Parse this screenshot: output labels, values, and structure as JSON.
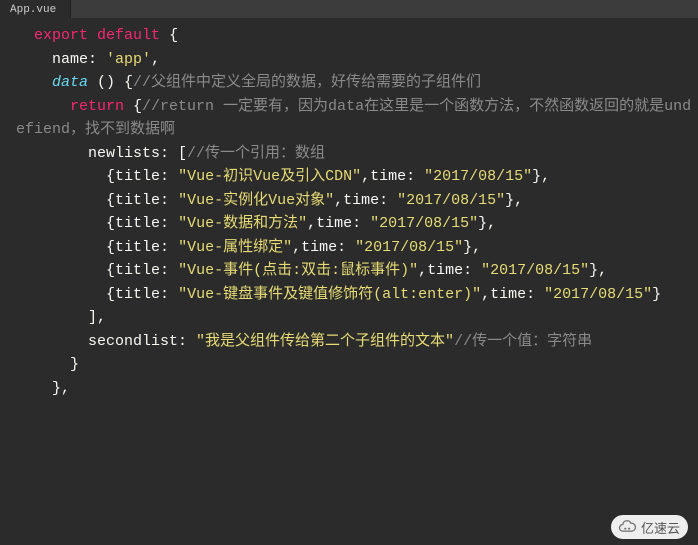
{
  "tab": {
    "filename": "App.vue"
  },
  "code": {
    "kw_export": "export",
    "kw_default": "default",
    "obj_open": " {",
    "name_key": "name",
    "colon": ": ",
    "name_val": "'app'",
    "comma": ",",
    "data_key": "data",
    "data_parens": " () {",
    "data_comment": "//父组件中定义全局的数据，好传给需要的子组件们",
    "return_kw": "return",
    "return_open": " {",
    "return_comment": "//return 一定要有，因为data在这里是一个函数方法，不然函数返回的就是undefiend，找不到数据啊",
    "newlists_key": "newlists",
    "newlists_open": ": [",
    "newlists_comment": "//传一个引用：数组",
    "items": [
      {
        "title_key": "title",
        "title_val": "\"Vue-初识Vue及引入CDN\"",
        "time_key": "time",
        "time_val": "\"2017/08/15\""
      },
      {
        "title_key": "title",
        "title_val": "\"Vue-实例化Vue对象\"",
        "time_key": "time",
        "time_val": "\"2017/08/15\""
      },
      {
        "title_key": "title",
        "title_val": "\"Vue-数据和方法\"",
        "time_key": "time",
        "time_val": "\"2017/08/15\""
      },
      {
        "title_key": "title",
        "title_val": "\"Vue-属性绑定\"",
        "time_key": "time",
        "time_val": "\"2017/08/15\""
      },
      {
        "title_key": "title",
        "title_val": "\"Vue-事件(点击:双击:鼠标事件)\"",
        "time_key": "time",
        "time_val": "\"2017/08/15\""
      },
      {
        "title_key": "title",
        "title_val": "\"Vue-键盘事件及键值修饰符(alt:enter)\"",
        "time_key": "time",
        "time_val": "\"2017/08/15\""
      }
    ],
    "arr_close": "],",
    "secondlist_key": "secondlist",
    "secondlist_val": "\"我是父组件传给第二个子组件的文本\"",
    "secondlist_comment": "//传一个值：字符串",
    "brace_close": "}",
    "brace_close_comma": "},"
  },
  "watermark": {
    "text": "亿速云"
  }
}
